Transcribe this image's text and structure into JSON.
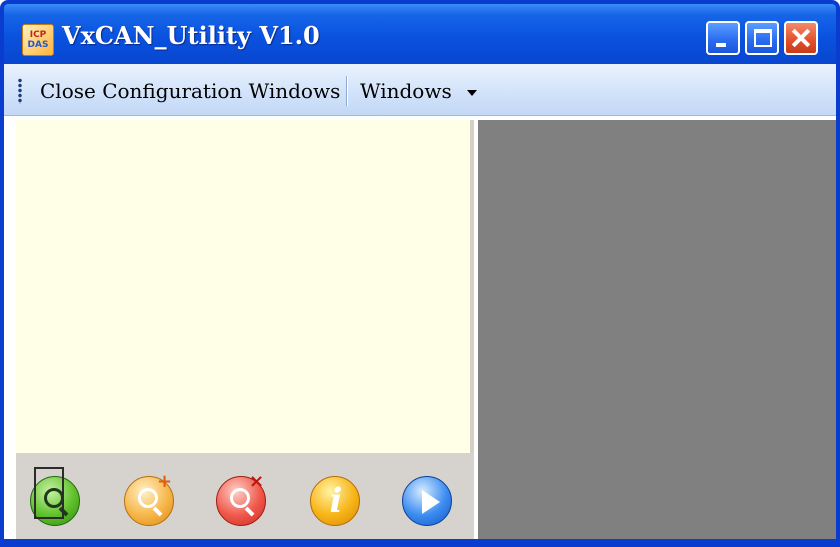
{
  "window": {
    "title": "VxCAN_Utility V1.0",
    "icon": "app-logo-icon",
    "icon_text_top": "ICP",
    "icon_text_bottom": "DAS",
    "controls": [
      "minimize-icon",
      "maximize-icon",
      "close-icon"
    ]
  },
  "menu": {
    "items": [
      {
        "label": "Close Configuration Windows"
      },
      {
        "label": "Windows",
        "has_dropdown": true
      }
    ]
  },
  "toolbar": {
    "tools": [
      {
        "name": "scan",
        "icon": "magnifier-icon"
      },
      {
        "name": "add",
        "icon": "magnifier-plus-icon",
        "badge": "+"
      },
      {
        "name": "remove",
        "icon": "magnifier-remove-icon",
        "badge": "×"
      },
      {
        "name": "info",
        "icon": "info-icon",
        "glyph": "i"
      },
      {
        "name": "run",
        "icon": "play-icon"
      }
    ]
  },
  "colors": {
    "titlebar": "#0a52df",
    "menubar": "#d2e3fa",
    "tree_background": "#fffee6",
    "mdi_background": "#808080"
  }
}
